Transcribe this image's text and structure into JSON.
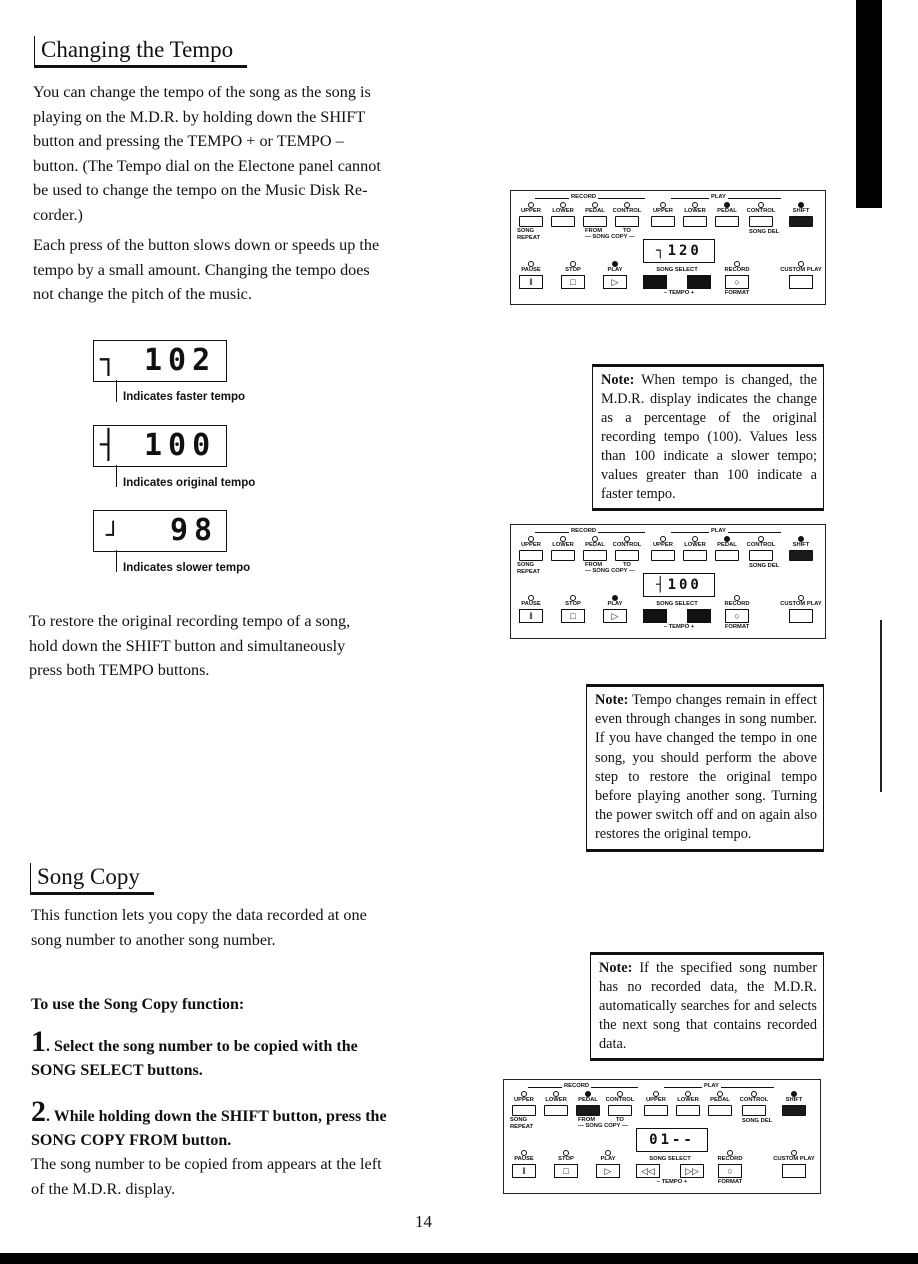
{
  "page_number": "14",
  "tempo_section": {
    "heading": "Changing the Tempo",
    "paragraph_1": "You can change the tempo of the song as the song is playing on the M.D.R. by holding down the SHIFT button and pressing the TEMPO + or TEMPO – button. (The Tempo dial on the Electone panel cannot be used to change the tempo on the Music Disk Recorder.)",
    "paragraph_1_lines": [
      "You can change the tempo of the song as the song is",
      "playing on the M.D.R. by holding down the SHIFT",
      "button and pressing the TEMPO + or TEMPO –",
      "button. (The Tempo dial on the Electone panel cannot",
      "be used to change the tempo on the Music Disk Re-",
      "corder.)"
    ],
    "paragraph_2_lines": [
      "Each press of the button slows down or speeds up the",
      "tempo by a small amount. Changing the tempo does",
      "not change the pitch of the music."
    ],
    "displays": [
      {
        "indicator": "┐",
        "value": "102",
        "caption": "Indicates faster tempo"
      },
      {
        "indicator": "┤",
        "value": "100",
        "caption": "Indicates original tempo"
      },
      {
        "indicator": "┘",
        "value": "98",
        "caption": "Indicates slower tempo"
      }
    ],
    "restore_lines": [
      "To restore the original recording tempo of a song,",
      "hold down the SHIFT button and simultaneously",
      "press both TEMPO buttons."
    ]
  },
  "notes": [
    {
      "label": "Note:",
      "text": "When tempo is changed, the M.D.R. display indicates the change as a percentage of the original recording tempo (100). Values less than 100 indicate a slower tempo; values greater than 100 indicate a faster tempo."
    },
    {
      "label": "Note:",
      "text": "Tempo changes remain in effect even through changes in song number. If you have changed the tempo in one song, you should perform the above step to restore the original tempo before playing another song. Turning the power switch off and on again also restores the original tempo."
    },
    {
      "label": "Note:",
      "text": "If the specified song number has no recorded data, the M.D.R. automatically searches for and selects the next song that contains recorded data."
    }
  ],
  "song_copy_section": {
    "heading": "Song Copy",
    "intro_lines": [
      "This function lets you copy the data recorded at one",
      "song number to another song number."
    ],
    "subheading": "To use the Song Copy function:",
    "steps": [
      {
        "number": "1",
        "text_lines": [
          "Select the song number to be copied with the",
          "SONG SELECT buttons."
        ]
      },
      {
        "number": "2",
        "text_lines": [
          "While holding down the SHIFT button, press the",
          "SONG COPY FROM button."
        ],
        "detail_lines": [
          "The song number to be copied from appears at the left",
          "of the M.D.R. display."
        ]
      }
    ]
  },
  "panel_labels": {
    "record_group": "RECORD",
    "play_group": "PLAY",
    "top_buttons": [
      "UPPER",
      "LOWER",
      "PEDAL",
      "CONTROL",
      "UPPER",
      "LOWER",
      "PEDAL",
      "CONTROL",
      "SHIFT"
    ],
    "song_repeat": "SONG\nREPEAT",
    "from": "FROM",
    "to": "TO",
    "song_copy": "— SONG COPY —",
    "song_del": "SONG DEL",
    "bottom_buttons": [
      "PAUSE",
      "STOP",
      "PLAY",
      "SONG SELECT",
      "RECORD",
      "CUSTOM PLAY"
    ],
    "tempo": "–  TEMPO  +",
    "format": "FORMAT"
  },
  "panels": [
    {
      "display": "┐120",
      "top_leds_on": [
        false,
        false,
        false,
        false,
        false,
        false,
        true,
        false,
        true
      ],
      "bottom_leds_on": [
        false,
        false,
        true,
        false,
        false
      ],
      "dark_top_buttons": [
        8
      ],
      "song_select_dark": true,
      "song_select_icons": [
        "",
        ""
      ]
    },
    {
      "display": "┤100",
      "top_leds_on": [
        false,
        false,
        false,
        false,
        false,
        false,
        true,
        false,
        true
      ],
      "bottom_leds_on": [
        false,
        false,
        true,
        false,
        false
      ],
      "dark_top_buttons": [
        8
      ],
      "song_select_dark": true,
      "song_select_icons": [
        "",
        ""
      ]
    },
    {
      "display": "01--",
      "top_leds_on": [
        false,
        false,
        true,
        false,
        false,
        false,
        false,
        false,
        true
      ],
      "bottom_leds_on": [
        false,
        false,
        false,
        false,
        false
      ],
      "dark_top_buttons": [
        2,
        8
      ],
      "song_select_dark": false,
      "song_select_icons": [
        "◁◁",
        "▷▷"
      ]
    }
  ]
}
